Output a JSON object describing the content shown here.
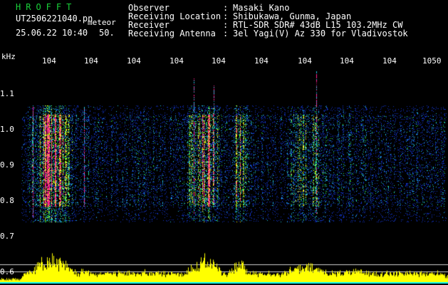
{
  "app": {
    "brand": "HROFFT",
    "filename": "UT2506221040.pn",
    "meteor_label": "meteor",
    "timestamp": "25.06.22 10:40",
    "count": "50."
  },
  "info": {
    "rows": [
      {
        "key": "Observer",
        "sep": ":",
        "value": "Masaki Kano"
      },
      {
        "key": "Receiving Location",
        "sep": ":",
        "value": "Shibukawa, Gunma, Japan"
      },
      {
        "key": "Receiver",
        "sep": ":",
        "value": "RTL-SDR SDR# 43dB L15 103.2MHz CW"
      },
      {
        "key": "Receiving Antenna",
        "sep": ":",
        "value": "3el Yagi(V) Az 330 for Vladivostok"
      }
    ]
  },
  "chart_data": {
    "type": "heatmap",
    "x_tick_labels": [
      "104",
      "104",
      "104",
      "104",
      "104",
      "104",
      "104",
      "104",
      "104",
      "1050"
    ],
    "y_unit": "kHz",
    "y_tick_labels": [
      "1.1",
      "1.0",
      "0.9",
      "0.8",
      "0.7",
      "0.6"
    ],
    "ylim": [
      0.6,
      1.15
    ],
    "colors": {
      "background": "#000000",
      "low": "#1030c0",
      "mid_cyan": "#20c0e0",
      "mid_green": "#30e040",
      "mid_yellow": "#ffff20",
      "high": "#ff2090",
      "power_trace": "#ffff00",
      "baseline": "#00ffff"
    }
  }
}
